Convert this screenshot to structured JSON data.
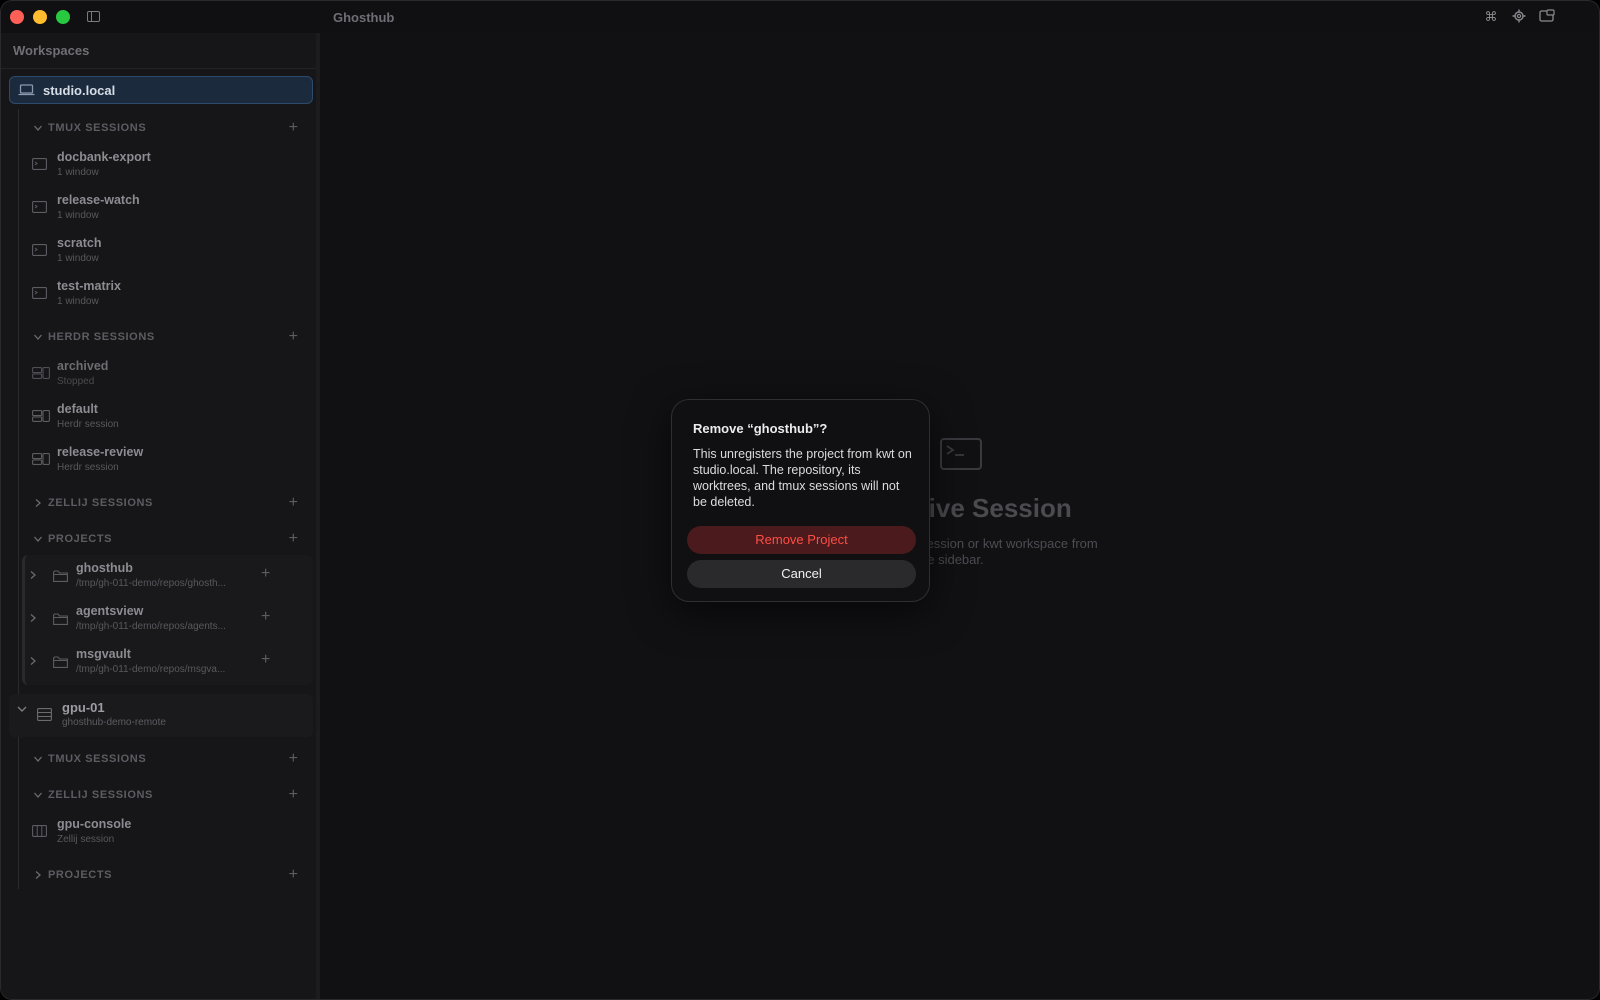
{
  "window": {
    "title": "Ghosthub"
  },
  "sidebar": {
    "header": "Workspaces",
    "hosts": [
      {
        "label": "studio.local",
        "tmux": {
          "title": "TMUX SESSIONS",
          "items": [
            {
              "name": "docbank-export",
              "sub": "1 window"
            },
            {
              "name": "release-watch",
              "sub": "1 window"
            },
            {
              "name": "scratch",
              "sub": "1 window"
            },
            {
              "name": "test-matrix",
              "sub": "1 window"
            }
          ]
        },
        "herdr": {
          "title": "HERDR SESSIONS",
          "items": [
            {
              "name": "archived",
              "sub": "Stopped"
            },
            {
              "name": "default",
              "sub": "Herdr session"
            },
            {
              "name": "release-review",
              "sub": "Herdr session"
            }
          ]
        },
        "zellij": {
          "title": "ZELLIJ SESSIONS"
        },
        "projects": {
          "title": "PROJECTS",
          "items": [
            {
              "name": "ghosthub",
              "sub": "/tmp/gh-011-demo/repos/ghosth..."
            },
            {
              "name": "agentsview",
              "sub": "/tmp/gh-011-demo/repos/agents..."
            },
            {
              "name": "msgvault",
              "sub": "/tmp/gh-011-demo/repos/msgva..."
            }
          ]
        }
      },
      {
        "label": "gpu-01",
        "sub": "ghosthub-demo-remote",
        "tmux": {
          "title": "TMUX SESSIONS"
        },
        "zellij": {
          "title": "ZELLIJ SESSIONS",
          "items": [
            {
              "name": "gpu-console",
              "sub": "Zellij session"
            }
          ]
        },
        "projects": {
          "title": "PROJECTS"
        }
      }
    ]
  },
  "main": {
    "empty_title": "tive Session",
    "empty_desc_line1": "session or kwt workspace from",
    "empty_desc_line2": "he sidebar."
  },
  "dialog": {
    "title": "Remove “ghosthub”?",
    "body": "This unregisters the project from kwt on studio.local. The repository, its worktrees, and tmux sessions will not be deleted.",
    "confirm_label": "Remove Project",
    "cancel_label": "Cancel"
  },
  "colors": {
    "accent": "#2d4a6b",
    "danger": "#ff4d45",
    "danger_bg": "#4a1a1c"
  }
}
